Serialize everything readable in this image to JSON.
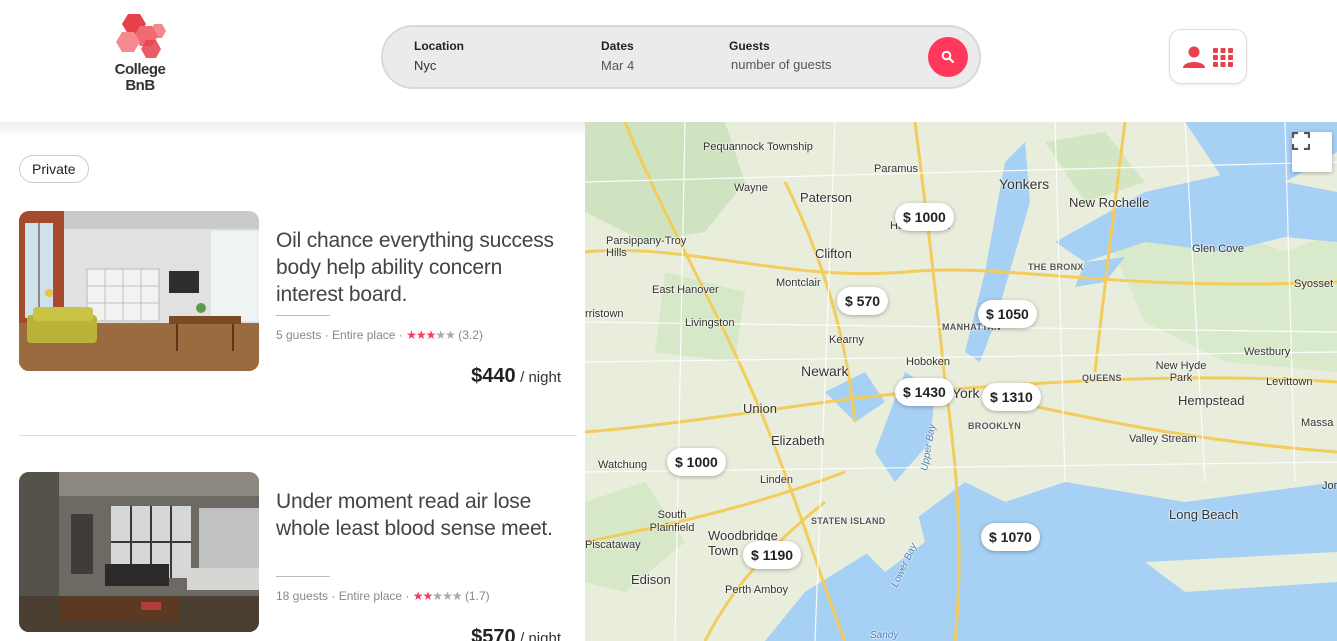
{
  "brand": {
    "logo_text_line1": "College",
    "logo_text_line2": "BnB",
    "colors": {
      "accent": "#ff385c",
      "logo_red": "#e8414b"
    }
  },
  "search": {
    "location": {
      "label": "Location",
      "value": "Nyc"
    },
    "dates": {
      "label": "Dates",
      "value": "Mar 4"
    },
    "guests": {
      "label": "Guests",
      "placeholder": "number of guests"
    },
    "button_icon": "search-icon"
  },
  "user_menu": {
    "icons": [
      "user-icon",
      "grid-icon"
    ]
  },
  "filters": [
    {
      "label": "Private"
    }
  ],
  "listings": [
    {
      "title": "Oil chance everything success body help ability concern interest board.",
      "guests": "5 guests",
      "type": "Entire place",
      "rating": 3.2,
      "rating_text": "(3.2)",
      "price": "$440",
      "per": "/ night"
    },
    {
      "title": "Under moment read air lose whole least blood sense meet.",
      "guests": "18 guests",
      "type": "Entire place",
      "rating": 1.7,
      "rating_text": "(1.7)",
      "price": "$570",
      "per": "/ night"
    }
  ],
  "map": {
    "pins": [
      "$ 1000",
      "$ 570",
      "$ 1050",
      "$ 1430",
      "$ 1310",
      "$ 1000",
      "$ 1190",
      "$ 1070"
    ],
    "places": [
      "Pequannock Township",
      "Paramus",
      "Yonkers",
      "New Rochelle",
      "Wayne",
      "Paterson",
      "Parsippany-Troy Hills",
      "Clifton",
      "Glen Cove",
      "THE BRONX",
      "Syosset",
      "East Hanover",
      "Montclair",
      "rristown",
      "Livingston",
      "MANHATTAN",
      "Kearny",
      "Westbury",
      "New Hyde Park",
      "QUEENS",
      "Newark",
      "Hoboken",
      "Union",
      "BROOKLYN",
      "Hempstead",
      "Levittown",
      "Elizabeth",
      "Valley Stream",
      "Massa",
      "Watchung",
      "Linden",
      "South Plainfield",
      "STATEN ISLAND",
      "Long Beach",
      "Jon",
      "Woodbridge Town",
      "Piscataway",
      "Edison",
      "Perth Amboy",
      "Upper Bay",
      "Lower Bay",
      "Sandy",
      "Hackensack",
      "York"
    ],
    "fullscreen_icon": "fullscreen-icon"
  }
}
